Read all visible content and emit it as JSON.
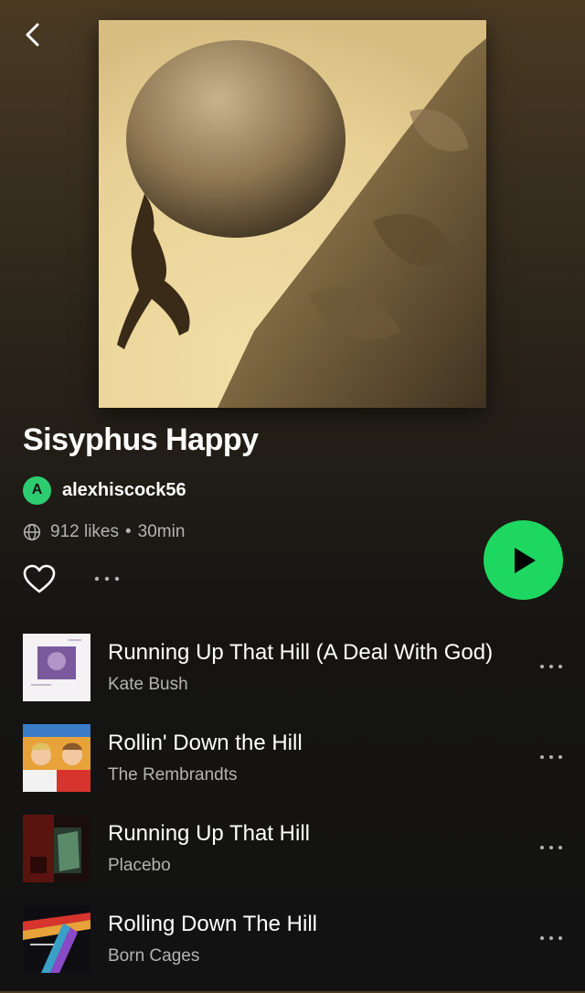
{
  "colors": {
    "accent": "#1ed760",
    "owner_avatar_bg": "#2ecc71",
    "text_primary": "#ffffff",
    "text_secondary": "#b3b3b3"
  },
  "nav": {
    "back_icon": "chevron-left-icon"
  },
  "playlist": {
    "title": "Sisyphus Happy",
    "owner_initial": "A",
    "owner": "alexhiscock56",
    "likes": "912 likes",
    "separator": "•",
    "duration": "30min"
  },
  "actions": {
    "like_icon": "heart-outline-icon",
    "more_icon": "more-horizontal-icon",
    "play_icon": "play-icon"
  },
  "tracks": [
    {
      "title": "Running Up That Hill (A Deal With God)",
      "artist": "Kate Bush"
    },
    {
      "title": "Rollin' Down the Hill",
      "artist": "The Rembrandts"
    },
    {
      "title": "Running Up That Hill",
      "artist": "Placebo"
    },
    {
      "title": "Rolling Down The Hill",
      "artist": "Born Cages"
    }
  ]
}
